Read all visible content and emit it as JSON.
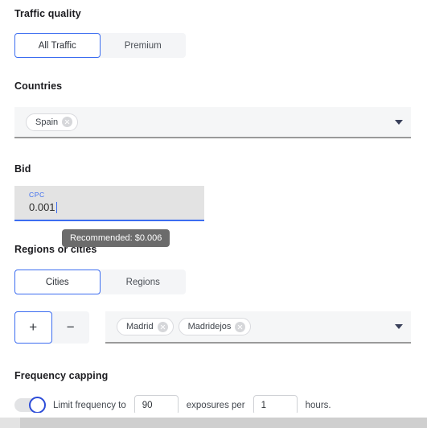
{
  "traffic_quality": {
    "title": "Traffic quality",
    "options": [
      {
        "label": "All Traffic",
        "selected": true
      },
      {
        "label": "Premium",
        "selected": false
      }
    ]
  },
  "countries": {
    "title": "Countries",
    "tags": [
      {
        "label": "Spain"
      }
    ],
    "caret": "chevron-down-icon"
  },
  "bid": {
    "title": "Bid",
    "field_label": "CPC",
    "value": "0.001",
    "tooltip": "Recommended: $0.006"
  },
  "regions_or_cities": {
    "title": "Regions or cities",
    "options": [
      {
        "label": "Cities",
        "selected": true
      },
      {
        "label": "Regions",
        "selected": false
      }
    ],
    "include_exclude": [
      {
        "label": "+",
        "name": "include-button",
        "selected": true
      },
      {
        "label": "−",
        "name": "exclude-button",
        "selected": false
      }
    ],
    "tags": [
      {
        "label": "Madrid"
      },
      {
        "label": "Madridejos"
      }
    ],
    "caret": "chevron-down-icon"
  },
  "frequency_capping": {
    "title": "Frequency capping",
    "enabled": true,
    "text_before": "Limit frequency to",
    "exposures_value": "90",
    "text_middle": "exposures per",
    "hours_value": "1",
    "text_after": "hours."
  },
  "colors": {
    "accent": "#3c6df0",
    "toggle_on": "#2b4bd8",
    "tooltip_bg": "#6b6b6b",
    "field_bg": "#f5f6f7",
    "bid_bg": "#e3e3e3"
  }
}
